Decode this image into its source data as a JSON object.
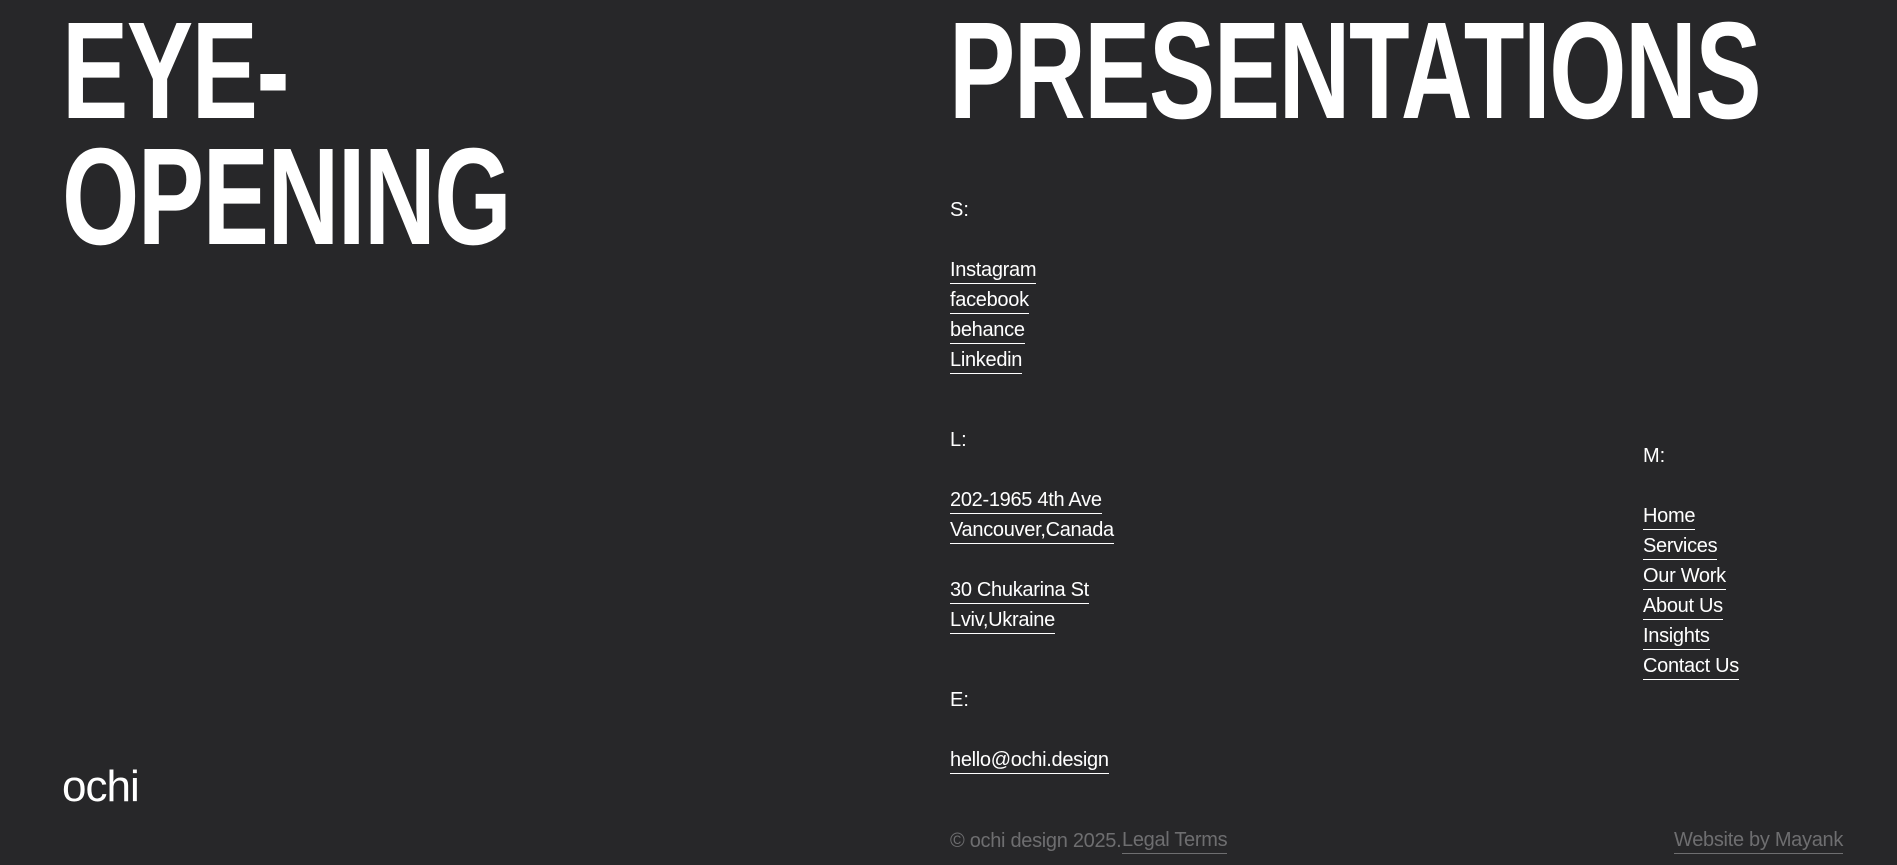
{
  "headline": {
    "line1": "EYE-",
    "line2": "OPENING",
    "right": "PRESENTATIONS"
  },
  "socials": {
    "label": "S:",
    "items": [
      "Instagram",
      "facebook",
      "behance",
      "Linkedin"
    ]
  },
  "locations": {
    "label": "L:",
    "addresses": [
      {
        "line1": "202-1965 4th Ave",
        "line2": "Vancouver,Canada"
      },
      {
        "line1": "30 Chukarina St",
        "line2": "Lviv,Ukraine"
      }
    ]
  },
  "email": {
    "label": "E:",
    "value": "hello@ochi.design"
  },
  "menu": {
    "label": "M:",
    "items": [
      "Home",
      "Services",
      "Our Work",
      "About Us",
      "Insights",
      "Contact Us"
    ]
  },
  "logo": "ochi",
  "footer": {
    "copyright": "© ochi design 2025.",
    "legal": "Legal Terms",
    "credit": "Website by Mayank"
  },
  "colors": {
    "background": "#272729",
    "text": "#ffffff",
    "muted": "#6e6e70"
  }
}
